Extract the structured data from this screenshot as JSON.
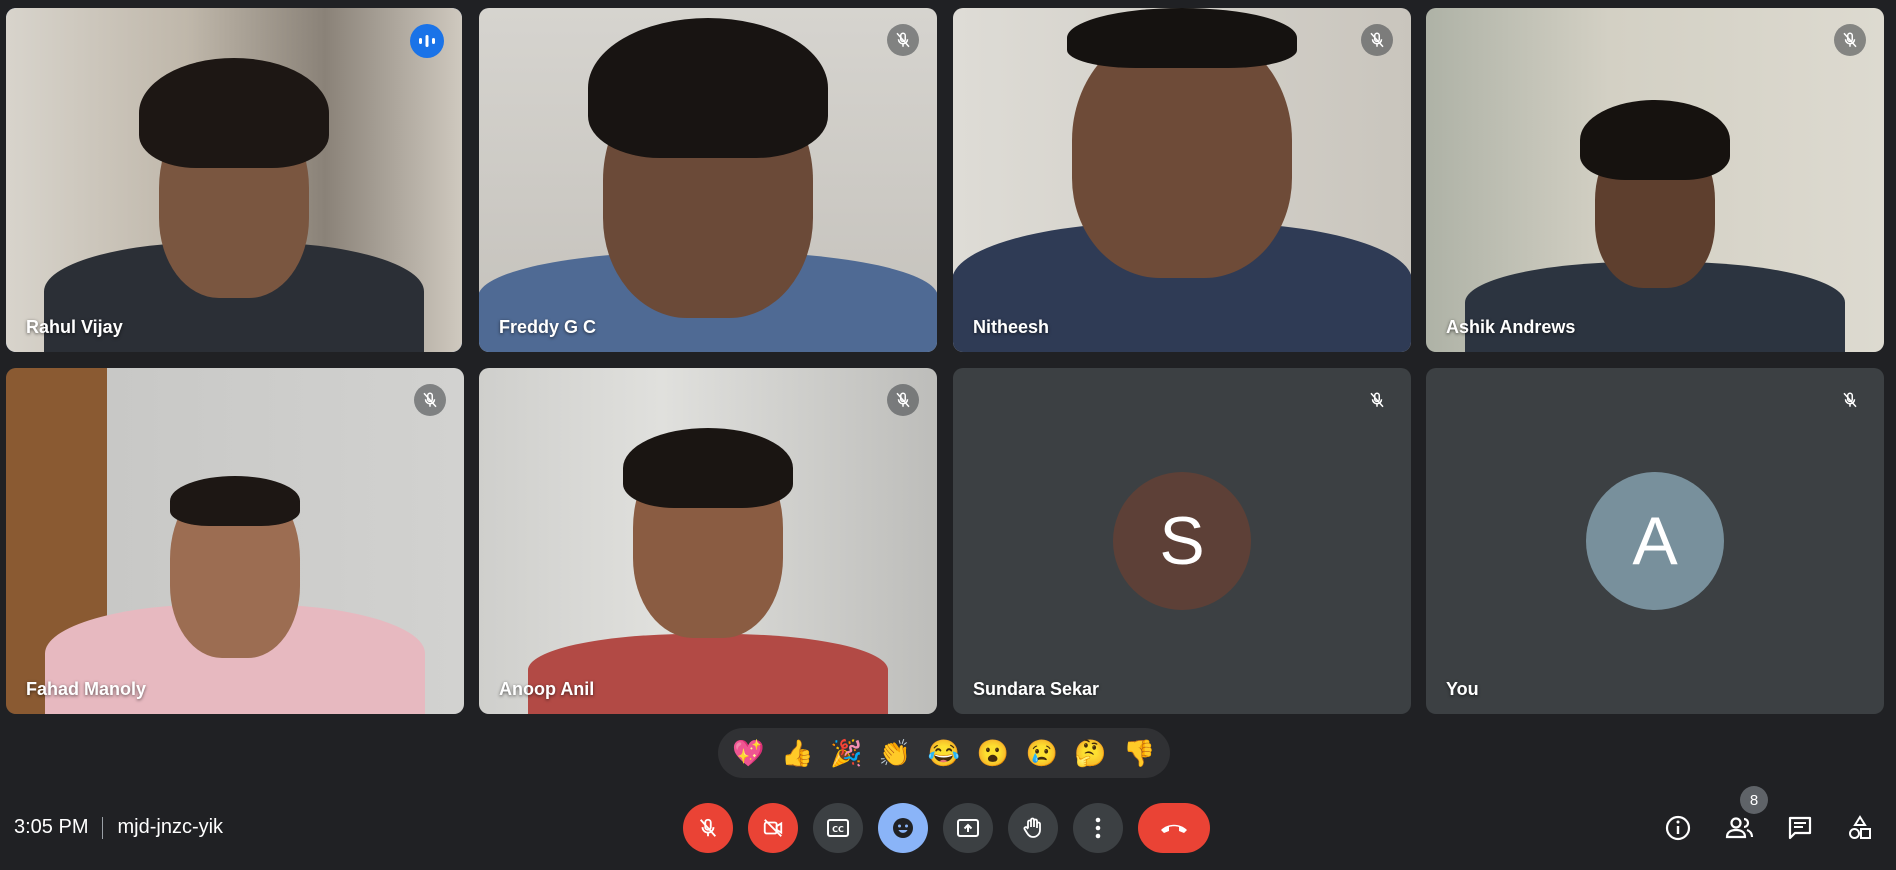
{
  "participants": [
    {
      "name": "Rahul Vijay",
      "state": "speaking",
      "active": true
    },
    {
      "name": "Freddy G C",
      "state": "muted"
    },
    {
      "name": "Nitheesh",
      "state": "muted"
    },
    {
      "name": "Ashik Andrews",
      "state": "muted"
    },
    {
      "name": "Fahad Manoly",
      "state": "muted"
    },
    {
      "name": "Anoop Anil",
      "state": "muted"
    },
    {
      "name": "Sundara Sekar",
      "state": "muted",
      "avatar_letter": "S",
      "avatar_color": "#5d4037"
    },
    {
      "name": "You",
      "state": "muted",
      "avatar_letter": "A",
      "avatar_color": "#78909c"
    }
  ],
  "reactions": [
    {
      "emoji": "💖",
      "icon": "sparkling-heart-icon"
    },
    {
      "emoji": "👍",
      "icon": "thumbs-up-icon"
    },
    {
      "emoji": "🎉",
      "icon": "party-popper-icon"
    },
    {
      "emoji": "👏",
      "icon": "clapping-hands-icon"
    },
    {
      "emoji": "😂",
      "icon": "tears-of-joy-icon"
    },
    {
      "emoji": "😮",
      "icon": "surprised-face-icon"
    },
    {
      "emoji": "😢",
      "icon": "crying-face-icon"
    },
    {
      "emoji": "🤔",
      "icon": "thinking-face-icon"
    },
    {
      "emoji": "👎",
      "icon": "thumbs-down-icon"
    }
  ],
  "meeting": {
    "time": "3:05 PM",
    "code": "mjd-jnzc-yik"
  },
  "people_count": "8",
  "colors": {
    "background": "#202124",
    "tile": "#3c4043",
    "danger": "#ea4335",
    "accent": "#8ab4f8"
  }
}
